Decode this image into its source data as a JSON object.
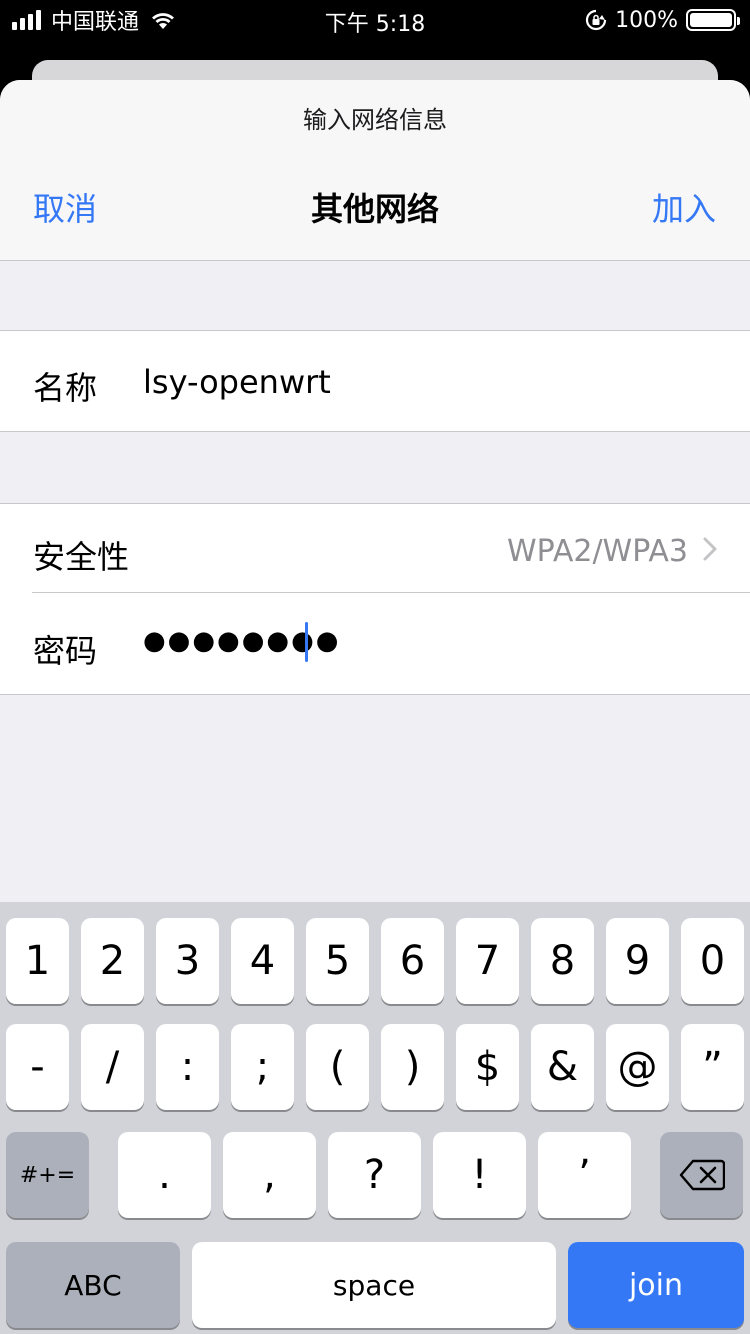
{
  "status_bar": {
    "carrier": "中国联通",
    "time": "下午 5:18",
    "battery": "100%"
  },
  "sheet": {
    "prompt": "输入网络信息",
    "cancel_label": "取消",
    "title": "其他网络",
    "join_label": "加入"
  },
  "form": {
    "name_label": "名称",
    "name_value": "lsy-openwrt",
    "security_label": "安全性",
    "security_value": "WPA2/WPA3",
    "password_label": "密码",
    "password_value": "●●●●●●●●"
  },
  "keyboard": {
    "row1": [
      "1",
      "2",
      "3",
      "4",
      "5",
      "6",
      "7",
      "8",
      "9",
      "0"
    ],
    "row2": [
      "-",
      "/",
      ":",
      ";",
      "(",
      ")",
      "$",
      "&",
      "@",
      "”"
    ],
    "row3_mode": "#+=",
    "row3": [
      ".",
      ",",
      "?",
      "!",
      "’"
    ],
    "abc_label": "ABC",
    "space_label": "space",
    "join_label": "join"
  },
  "colors": {
    "accent": "#3478f6",
    "sheet_bg": "#efeff4",
    "keyboard_bg": "#d1d3d9"
  }
}
